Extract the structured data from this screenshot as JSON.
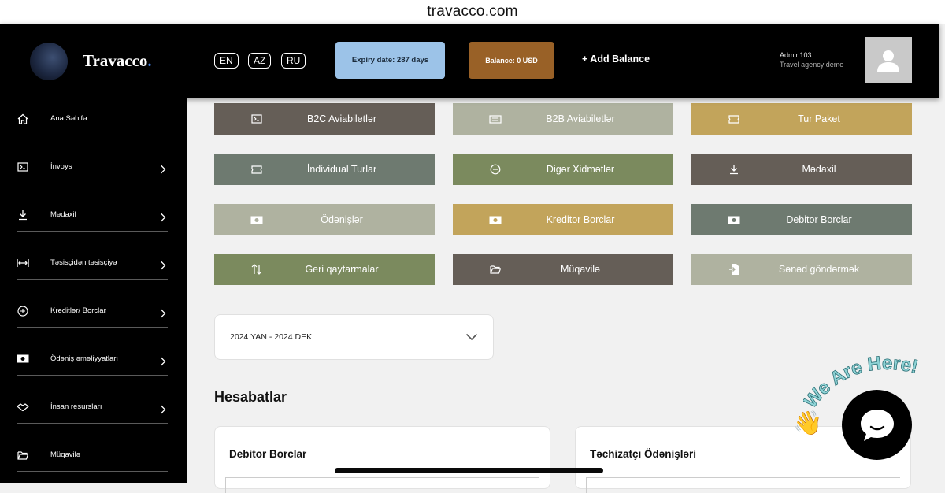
{
  "browser": {
    "url": "travacco.com"
  },
  "header": {
    "brand": "Travacco",
    "brand_dot": ".",
    "languages": [
      "EN",
      "AZ",
      "RU"
    ],
    "expiry": "Expiry date: 287 days",
    "balance": "Balance: 0 USD",
    "add_balance": "+ Add Balance",
    "user_name": "Admin103",
    "user_role": "Travel agency demo"
  },
  "sidebar": {
    "items": [
      {
        "label": "Ana Səhifə",
        "icon": "home-icon"
      },
      {
        "label": "İnvoys",
        "icon": "invoice-icon"
      },
      {
        "label": "Mədaxil",
        "icon": "download-icon"
      },
      {
        "label": "Təsisçidən təsisçiyə",
        "icon": "transfer-icon"
      },
      {
        "label": "Kreditlər/ Borclar",
        "icon": "credit-icon"
      },
      {
        "label": "Ödəniş əməliyyatları",
        "icon": "cash-icon"
      },
      {
        "label": "İnsan resursları",
        "icon": "handshake-icon"
      },
      {
        "label": "Müqavilə",
        "icon": "folder-icon"
      }
    ]
  },
  "tiles": [
    {
      "label": "B2C Aviabiletlər",
      "color": "#655e57",
      "icon": "invoice-icon"
    },
    {
      "label": "B2B Aviabiletlər",
      "color": "#afb2a0",
      "icon": "ticket-icon"
    },
    {
      "label": "Tur Paket",
      "color": "#c2a45b",
      "icon": "ticket-icon"
    },
    {
      "label": "İndividual Turlar",
      "color": "#6e7a70",
      "icon": "ticket-icon"
    },
    {
      "label": "Digər Xidmətlər",
      "color": "#7b8a5e",
      "icon": "circle-minus-icon"
    },
    {
      "label": "Mədaxil",
      "color": "#655e57",
      "icon": "download-icon"
    },
    {
      "label": "Ödənişlər",
      "color": "#afb2a0",
      "icon": "cash-icon"
    },
    {
      "label": "Kreditor Borclar",
      "color": "#c2a45b",
      "icon": "cash-icon"
    },
    {
      "label": "Debitor Borclar",
      "color": "#6e7a70",
      "icon": "cash-icon"
    },
    {
      "label": "Geri qaytarmalar",
      "color": "#7b8a5e",
      "icon": "swap-icon"
    },
    {
      "label": "Müqavilə",
      "color": "#655e57",
      "icon": "folder-icon"
    },
    {
      "label": "Sənəd göndərmək",
      "color": "#afb2a0",
      "icon": "file-send-icon"
    }
  ],
  "period": {
    "value": "2024 YAN - 2024 DEK"
  },
  "reports": {
    "title": "Hesabatlar",
    "cards": [
      {
        "title": "Debitor Borclar"
      },
      {
        "title": "Təchizatçı Ödənişləri"
      }
    ]
  },
  "chat": {
    "tagline": "We Are Here!"
  }
}
